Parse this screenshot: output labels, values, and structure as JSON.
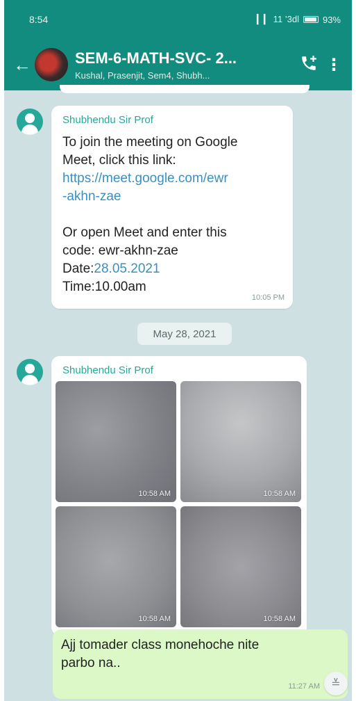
{
  "status_bar": {
    "time": "8:54",
    "signal": "▎▎ 11 ’3dl",
    "battery": "93%"
  },
  "header": {
    "title": "SEM-6-MATH-SVC- 2...",
    "subtitle": "Kushal, Prasenjit, Sem4, Shubh..."
  },
  "messages": [
    {
      "sender": "Shubhendu Sir Prof",
      "line1": "To join the meeting on Google",
      "line2": "Meet, click this link:",
      "link_line1": "https://meet.google.com/ewr",
      "link_line2": "-akhn-zae",
      "line3": "Or open Meet and enter this",
      "line4": "code: ewr-akhn-zae",
      "date_label": "Date:",
      "date_value": "28.05.2021",
      "time_line": "Time:10.00am",
      "timestamp": "10:05 PM"
    }
  ],
  "date_separator": "May 28, 2021",
  "photo_message": {
    "sender": "Shubhendu Sir Prof",
    "photos": [
      {
        "timestamp": "10:58 AM"
      },
      {
        "timestamp": "10:58 AM"
      },
      {
        "timestamp": "10:58 AM"
      },
      {
        "timestamp": "10:58 AM"
      }
    ]
  },
  "outgoing_message": {
    "line1": "Ajj tomader class monehoche nite",
    "line2": "parbo na..",
    "timestamp": "11:27 AM"
  },
  "colors": {
    "header": "#128c7e",
    "accent": "#25a89a",
    "link": "#3b8fbf",
    "outgoing": "#dcf8c6"
  },
  "icons": {
    "back": "arrow-left",
    "call": "phone-plus",
    "menu": "vertical-dots",
    "scroll_down": "double-chevron-down"
  }
}
